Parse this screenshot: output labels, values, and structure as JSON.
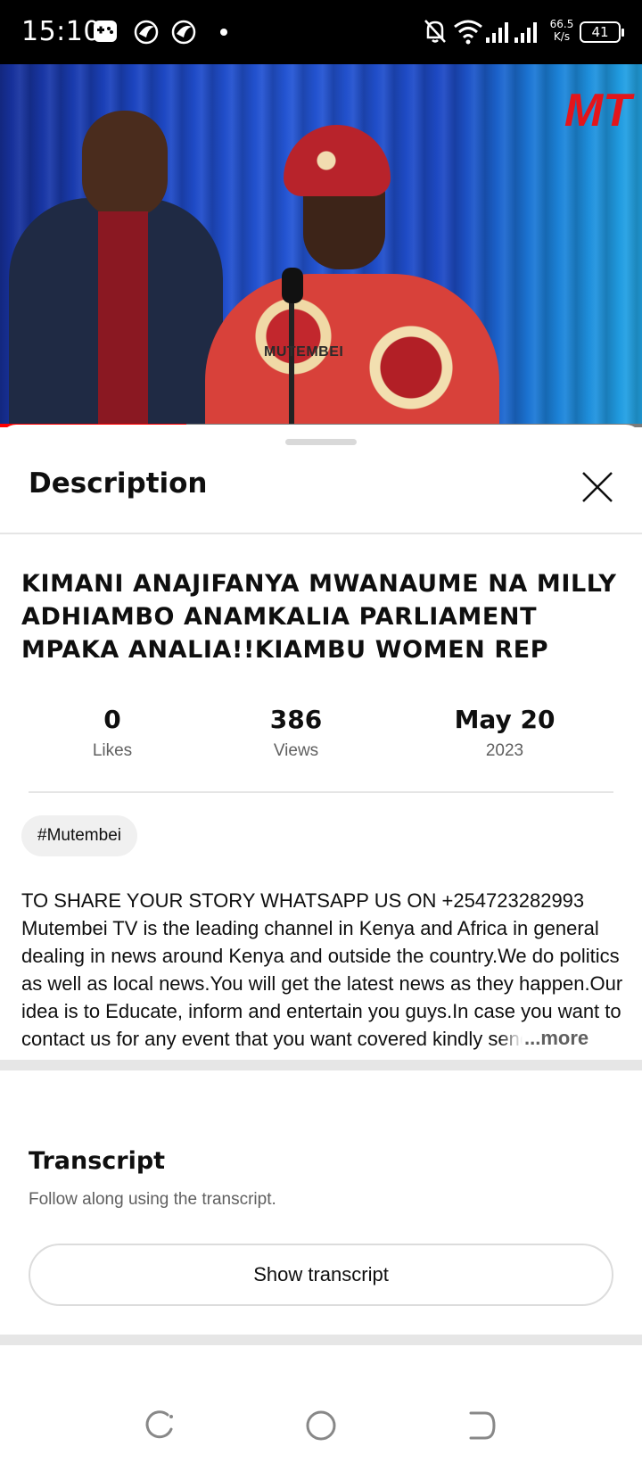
{
  "status_bar": {
    "time": "15:10",
    "net_speed_value": "66.5",
    "net_speed_unit": "K/s",
    "battery": "41",
    "icons": [
      "gamepad-icon",
      "app-bird-icon",
      "app-bird-icon",
      "dot-icon",
      "notifications-off-icon",
      "wifi-icon",
      "signal-icon",
      "signal-icon",
      "battery-icon"
    ]
  },
  "video": {
    "watermark": "MUTEMBEI",
    "logo": "MT",
    "progress": 0.29
  },
  "sheet": {
    "title": "Description",
    "video_title": "KIMANI ANAJIFANYA MWANAUME NA MILLY ADHIAMBO ANAMKALIA PARLIAMENT MPAKA ANALIA!!KIAMBU WOMEN REP",
    "stats": [
      {
        "value": "0",
        "label": "Likes"
      },
      {
        "value": "386",
        "label": "Views"
      },
      {
        "value": "May 20",
        "label": "2023"
      }
    ],
    "hashtag": "#Mutembei",
    "description": "TO SHARE YOUR STORY WHATSAPP US ON +254723282993 Mutembei TV is the leading channel in Kenya and Africa in general dealing in news around Kenya and outside the country.We do politics as well as local news.You will get the latest news as they happen.Our idea is to Educate, inform and entertain you guys.In case you want to contact us for any event that you want covered kindly send us an email adm",
    "more_label": "...more"
  },
  "transcript": {
    "heading": "Transcript",
    "subtitle": "Follow along using the transcript.",
    "button_label": "Show transcript"
  },
  "colors": {
    "accent_red": "#ff0000",
    "chip_bg": "#f0f0f0",
    "secondary_text": "#606060"
  }
}
